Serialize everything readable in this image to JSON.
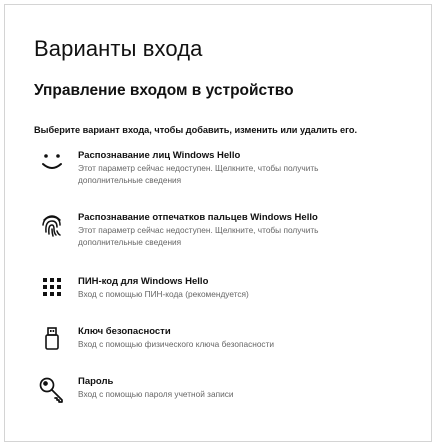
{
  "page": {
    "title": "Варианты входа",
    "section_title": "Управление входом в устройство",
    "instruction": "Выберите вариант входа, чтобы добавить, изменить или удалить его."
  },
  "options": [
    {
      "icon": "face-smile-icon",
      "name": "Распознавание лиц Windows Hello",
      "desc": "Этот параметр сейчас недоступен. Щелкните, чтобы получить дополнительные сведения"
    },
    {
      "icon": "fingerprint-icon",
      "name": "Распознавание отпечатков пальцев Windows Hello",
      "desc": "Этот параметр сейчас недоступен. Щелкните, чтобы получить дополнительные сведения"
    },
    {
      "icon": "pin-keypad-icon",
      "name": "ПИН-код для Windows Hello",
      "desc": "Вход с помощью ПИН-кода (рекомендуется)"
    },
    {
      "icon": "security-key-icon",
      "name": "Ключ безопасности",
      "desc": "Вход с помощью физического ключа безопасности"
    },
    {
      "icon": "password-key-icon",
      "name": "Пароль",
      "desc": "Вход с помощью пароля учетной записи"
    }
  ]
}
